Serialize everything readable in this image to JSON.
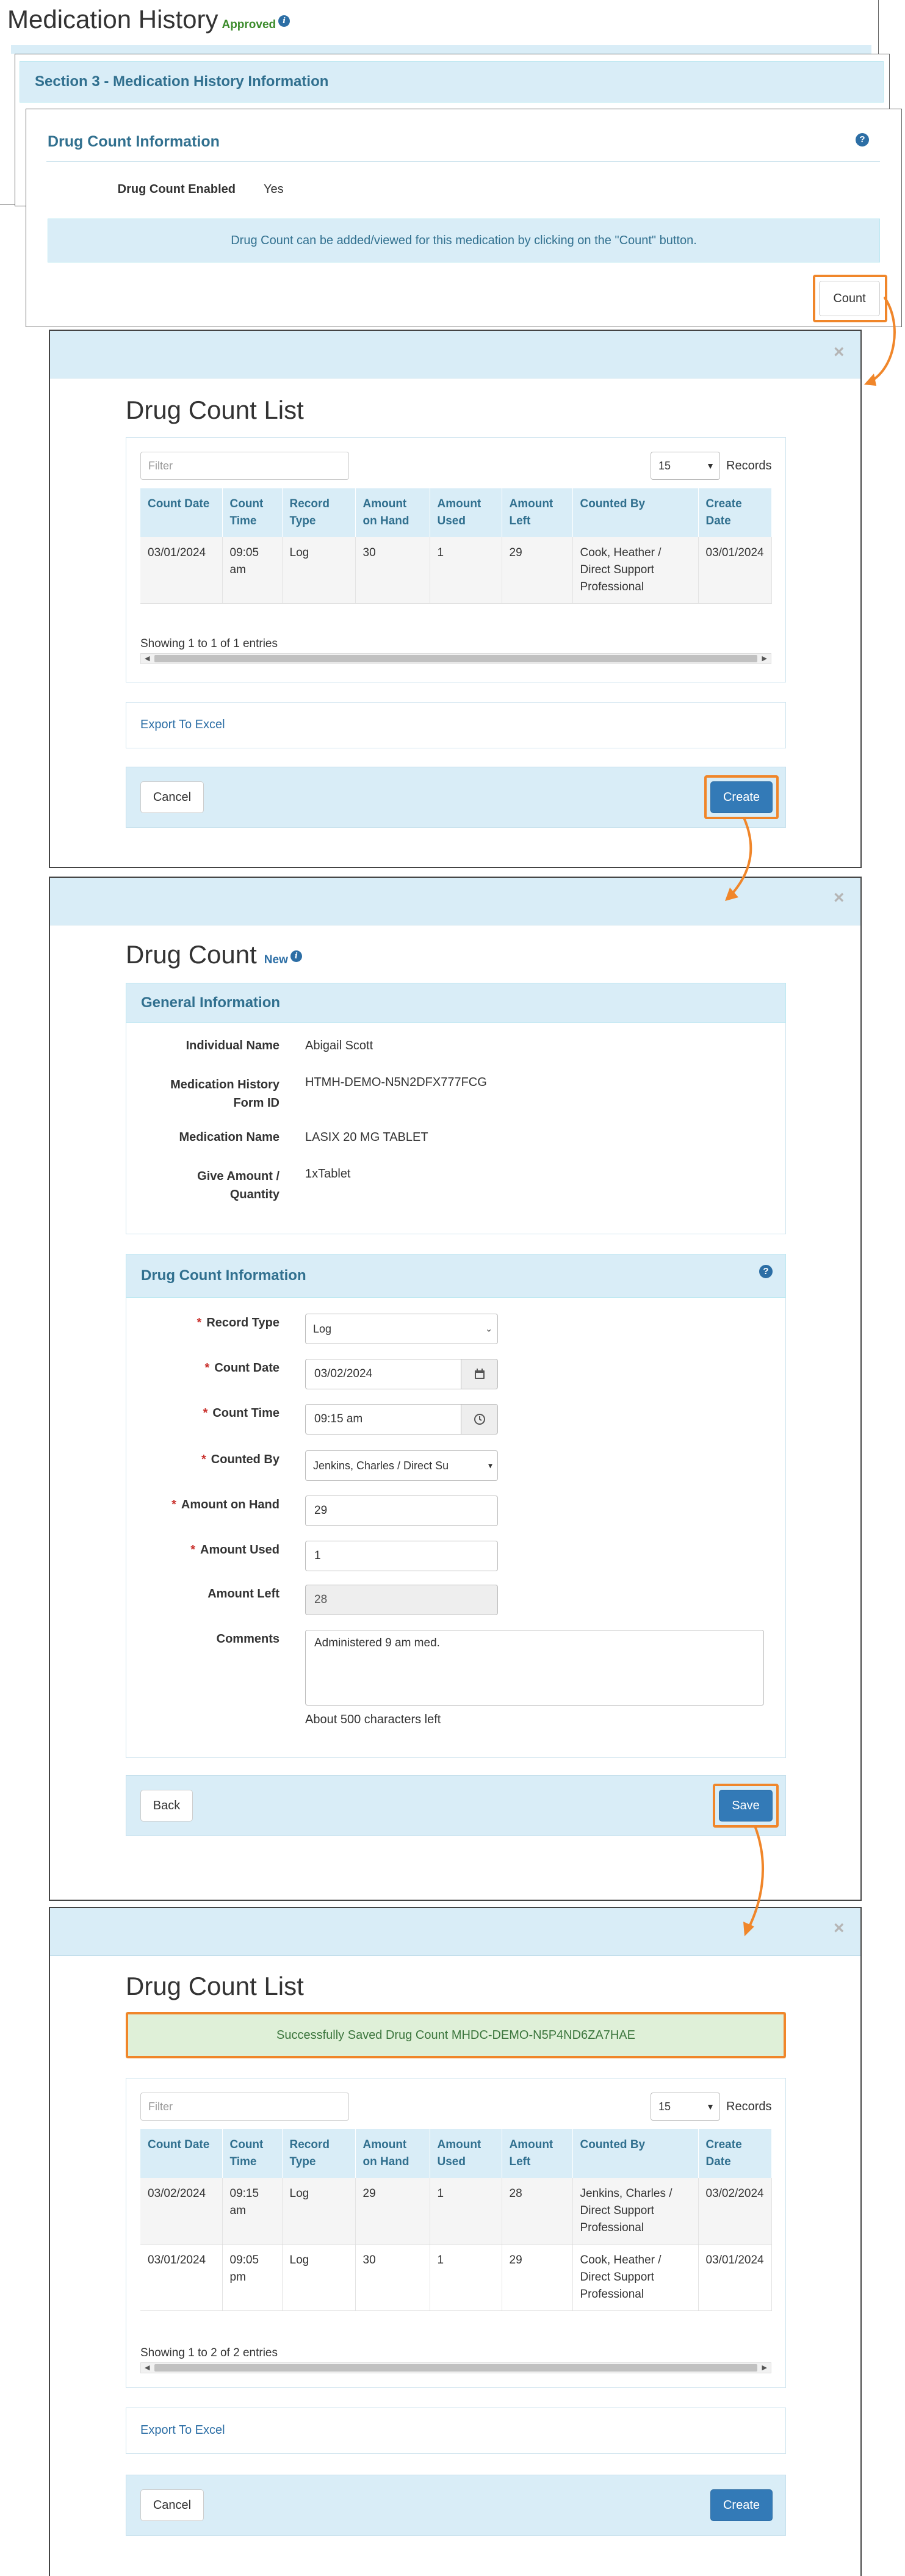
{
  "colors": {
    "accent": "#337ab7",
    "header_blue": "#d9edf7",
    "highlight": "#f0862a",
    "approved_green": "#3c8c2c"
  },
  "page": {
    "title": "Medication History",
    "status": "Approved"
  },
  "section3": {
    "title": "Section 3 - Medication History Information"
  },
  "drug_count_info_card": {
    "title": "Drug Count Information",
    "enabled_label": "Drug Count Enabled",
    "enabled_value": "Yes",
    "info_message": "Drug Count can be added/viewed for this medication by clicking on the \"Count\" button.",
    "count_button": "Count"
  },
  "list_modal_1": {
    "title": "Drug Count List",
    "filter_placeholder": "Filter",
    "page_size": "15",
    "records_label": "Records",
    "columns": [
      "Count Date",
      "Count Time",
      "Record Type",
      "Amount on Hand",
      "Amount Used",
      "Amount Left",
      "Counted By",
      "Create Date"
    ],
    "rows": [
      [
        "03/01/2024",
        "09:05 am",
        "Log",
        "30",
        "1",
        "29",
        "Cook, Heather / Direct Support Professional",
        "03/01/2024"
      ]
    ],
    "showing": "Showing 1 to 1 of 1 entries",
    "export_label": "Export To Excel",
    "cancel_label": "Cancel",
    "create_label": "Create"
  },
  "form_modal": {
    "title": "Drug Count",
    "status": "New",
    "general_title": "General Information",
    "general": [
      {
        "label": "Individual Name",
        "value": "Abigail Scott"
      },
      {
        "label": "Medication History Form ID",
        "value": "HTMH-DEMO-N5N2DFX777FCG"
      },
      {
        "label": "Medication Name",
        "value": "LASIX 20 MG TABLET"
      },
      {
        "label": "Give Amount / Quantity",
        "value": "1xTablet"
      }
    ],
    "count_info_title": "Drug Count Information",
    "fields": {
      "record_type": {
        "label": "Record Type",
        "value": "Log"
      },
      "count_date": {
        "label": "Count Date",
        "value": "03/02/2024"
      },
      "count_time": {
        "label": "Count Time",
        "value": "09:15 am"
      },
      "counted_by": {
        "label": "Counted By",
        "value": "Jenkins, Charles / Direct Su"
      },
      "amount_on_hand": {
        "label": "Amount on Hand",
        "value": "29"
      },
      "amount_used": {
        "label": "Amount Used",
        "value": "1"
      },
      "amount_left": {
        "label": "Amount Left",
        "value": "28"
      },
      "comments": {
        "label": "Comments",
        "value": "Administered 9 am med."
      }
    },
    "chars_left": "About 500 characters left",
    "back_label": "Back",
    "save_label": "Save"
  },
  "list_modal_2": {
    "title": "Drug Count List",
    "success_message": "Successfully Saved Drug Count MHDC-DEMO-N5P4ND6ZA7HAE",
    "filter_placeholder": "Filter",
    "page_size": "15",
    "records_label": "Records",
    "columns": [
      "Count Date",
      "Count Time",
      "Record Type",
      "Amount on Hand",
      "Amount Used",
      "Amount Left",
      "Counted By",
      "Create Date"
    ],
    "rows": [
      [
        "03/02/2024",
        "09:15 am",
        "Log",
        "29",
        "1",
        "28",
        "Jenkins, Charles / Direct Support Professional",
        "03/02/2024"
      ],
      [
        "03/01/2024",
        "09:05 pm",
        "Log",
        "30",
        "1",
        "29",
        "Cook, Heather / Direct Support Professional",
        "03/01/2024"
      ]
    ],
    "showing": "Showing 1 to 2 of 2 entries",
    "export_label": "Export To Excel",
    "cancel_label": "Cancel",
    "create_label": "Create"
  }
}
